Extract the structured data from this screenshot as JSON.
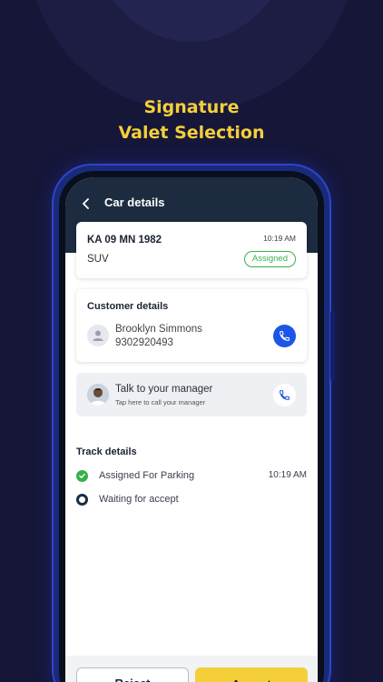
{
  "headline": {
    "line1": "Signature",
    "line2": "Valet Selection"
  },
  "appbar": {
    "title": "Car details",
    "back_icon": "chevron-left-icon"
  },
  "car": {
    "plate": "KA 09 MN 1982",
    "time": "10:19 AM",
    "type": "SUV",
    "status": "Assigned",
    "status_color": "#37b24d"
  },
  "customer": {
    "section_title": "Customer details",
    "name": "Brooklyn Simmons",
    "phone": "9302920493",
    "call_icon": "phone-icon"
  },
  "manager": {
    "title": "Talk to your manager",
    "subtitle": "Tap here to call your manager",
    "call_icon": "phone-icon"
  },
  "track": {
    "title": "Track details",
    "steps": [
      {
        "label": "Assigned For Parking",
        "time": "10:19 AM",
        "state": "done"
      },
      {
        "label": "Waiting for accept",
        "time": "",
        "state": "pending"
      }
    ]
  },
  "actions": {
    "reject_label": "Reject",
    "accept_label": "Accept"
  },
  "colors": {
    "background": "#161639",
    "headline": "#f4cf3a",
    "appbar": "#1c2b40",
    "primary_blue": "#1b56e8",
    "accept": "#f4cf3a",
    "success": "#34b249"
  }
}
